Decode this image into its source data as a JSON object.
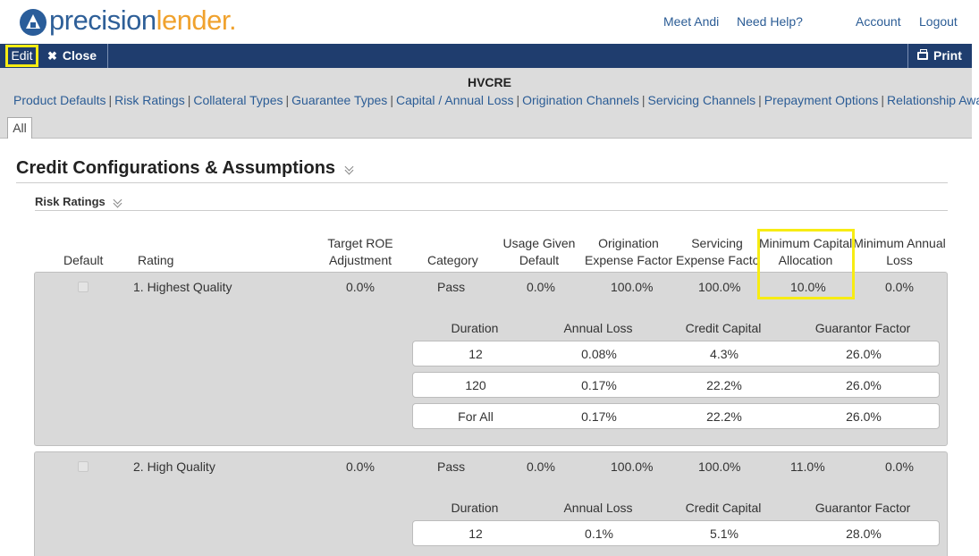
{
  "header": {
    "logo_part1": "precision",
    "logo_part2": "lender",
    "logo_dot": ".",
    "links": [
      "Meet Andi",
      "Need Help?",
      "Account",
      "Logout"
    ]
  },
  "toolbar": {
    "edit_label": "Edit",
    "close_label": "Close",
    "print_label": "Print"
  },
  "product_title": "HVCRE",
  "subnav": [
    "Product Defaults",
    "Risk Ratings",
    "Collateral Types",
    "Guarantee Types",
    "Capital / Annual Loss",
    "Origination Channels",
    "Servicing Channels",
    "Prepayment Options",
    "Relationship Awareness"
  ],
  "tab_all": "All",
  "section_title": "Credit Configurations & Assumptions",
  "subsection_title": "Risk Ratings",
  "columns": {
    "default": "Default",
    "rating": "Rating",
    "target_roe_1": "Target ROE",
    "target_roe_2": "Adjustment",
    "category": "Category",
    "usage_1": "Usage Given",
    "usage_2": "Default",
    "orig_1": "Origination",
    "orig_2": "Expense Factor",
    "serv_1": "Servicing",
    "serv_2": "Expense Factor",
    "mincap_1": "Minimum Capital",
    "mincap_2": "Allocation",
    "minloss_1": "Minimum Annual",
    "minloss_2": "Loss"
  },
  "sub_columns": {
    "duration": "Duration",
    "annual_loss": "Annual Loss",
    "credit_capital": "Credit Capital",
    "guarantor_factor": "Guarantor Factor"
  },
  "ratings": [
    {
      "rating": "1. Highest Quality",
      "target_roe": "0.0%",
      "category": "Pass",
      "usage": "0.0%",
      "origination": "100.0%",
      "servicing": "100.0%",
      "min_capital": "10.0%",
      "min_loss": "0.0%",
      "rows": [
        {
          "duration": "12",
          "annual_loss": "0.08%",
          "credit_capital": "4.3%",
          "guarantor_factor": "26.0%"
        },
        {
          "duration": "120",
          "annual_loss": "0.17%",
          "credit_capital": "22.2%",
          "guarantor_factor": "26.0%"
        },
        {
          "duration": "For All",
          "annual_loss": "0.17%",
          "credit_capital": "22.2%",
          "guarantor_factor": "26.0%"
        }
      ]
    },
    {
      "rating": "2. High Quality",
      "target_roe": "0.0%",
      "category": "Pass",
      "usage": "0.0%",
      "origination": "100.0%",
      "servicing": "100.0%",
      "min_capital": "11.0%",
      "min_loss": "0.0%",
      "rows": [
        {
          "duration": "12",
          "annual_loss": "0.1%",
          "credit_capital": "5.1%",
          "guarantor_factor": "28.0%"
        }
      ]
    }
  ],
  "colors": {
    "navbar": "#1f3d6e",
    "link": "#2b5c95",
    "highlight": "#f7ec13",
    "logo_blue": "#2e5f98",
    "logo_orange": "#f0a22e"
  }
}
